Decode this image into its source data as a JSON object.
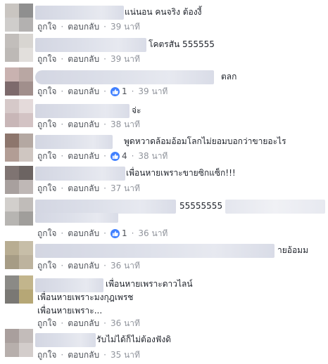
{
  "actions": {
    "like_label": "ถูกใจ",
    "reply_label": "ตอบกลับ",
    "separator": "·"
  },
  "comments": [
    {
      "text": "แน่นอน คนจริง ต้องงี้",
      "time": "39 นาที"
    },
    {
      "text": "โคตรสัน 555555",
      "time": "39 นาที"
    },
    {
      "text": "ตลก",
      "likes": "1",
      "time": "39 นาที"
    },
    {
      "text": "จ่ะ",
      "time": "38 นาที"
    },
    {
      "text": "พูดหวาดล้อมอ้อมโลกไม่ยอมบอกว่าขายอะไร",
      "likes": "4",
      "time": "38 นาที"
    },
    {
      "text": "เพื่อนหายเพราะขายซิกแซ็ก!!!",
      "time": "37 นาที"
    },
    {
      "text": "55555555",
      "likes": "1",
      "time": "36 นาที"
    },
    {
      "text": "ายอ้อมม",
      "time": "36 นาที"
    },
    {
      "text": "เพื่อนหายเพราะดาวไลน์\nเพื่อนหายเพราะมงกุฎเพรช\nเพื่อนหายเพราะ...",
      "time": "36 นาที"
    },
    {
      "text": "รับไม่ได้ก็ไม่ต้องฟังดิ",
      "time": "35 นาที"
    }
  ],
  "colors": {
    "like_blue": "#4080ff",
    "meta_gray": "#90949c",
    "action_gray": "#4b4f56"
  }
}
